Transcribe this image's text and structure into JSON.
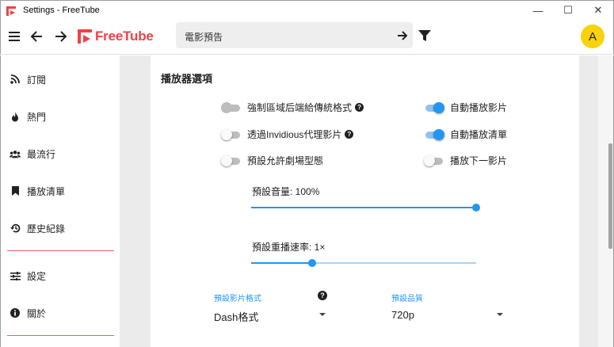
{
  "window": {
    "title": "Settings - FreeTube",
    "minimize": "—",
    "maximize": "☐",
    "close": "✕"
  },
  "topnav": {
    "logo_free": "Free",
    "logo_tube": "Tube",
    "search_value": "電影預告",
    "avatar_letter": "A"
  },
  "sidebar": {
    "items": [
      {
        "label": "訂閱",
        "icon": "rss-icon"
      },
      {
        "label": "熱門",
        "icon": "fire-icon"
      },
      {
        "label": "最流行",
        "icon": "users-icon"
      },
      {
        "label": "播放清單",
        "icon": "bookmark-icon"
      },
      {
        "label": "歷史紀錄",
        "icon": "history-icon"
      },
      {
        "label": "設定",
        "icon": "sliders-icon"
      },
      {
        "label": "關於",
        "icon": "info-icon"
      }
    ]
  },
  "player": {
    "section_title": "播放器選項",
    "toggles_left": [
      {
        "label": "強制區域后端給傳統格式",
        "state": "disabled",
        "help": true
      },
      {
        "label": "透過Invidious代理影片",
        "state": "off",
        "help": true
      },
      {
        "label": "預設允許劇場型態",
        "state": "off",
        "help": false
      }
    ],
    "toggles_right": [
      {
        "label": "自動播放影片",
        "state": "on"
      },
      {
        "label": "自動播放清單",
        "state": "on"
      },
      {
        "label": "播放下一影片",
        "state": "off"
      }
    ],
    "volume": {
      "label": "預設音量: 100%",
      "value": 1.0
    },
    "speed": {
      "label": "預設重播速率: 1×",
      "value": 0.27
    },
    "format": {
      "label": "預設影片格式",
      "value": "Dash格式"
    },
    "quality": {
      "label": "預設品質",
      "value": "720p"
    },
    "help_glyph": "?"
  },
  "colors": {
    "accent": "#2196f3",
    "brand": "#f04242",
    "avatar": "#f9d20c",
    "separator": "#f06060"
  }
}
